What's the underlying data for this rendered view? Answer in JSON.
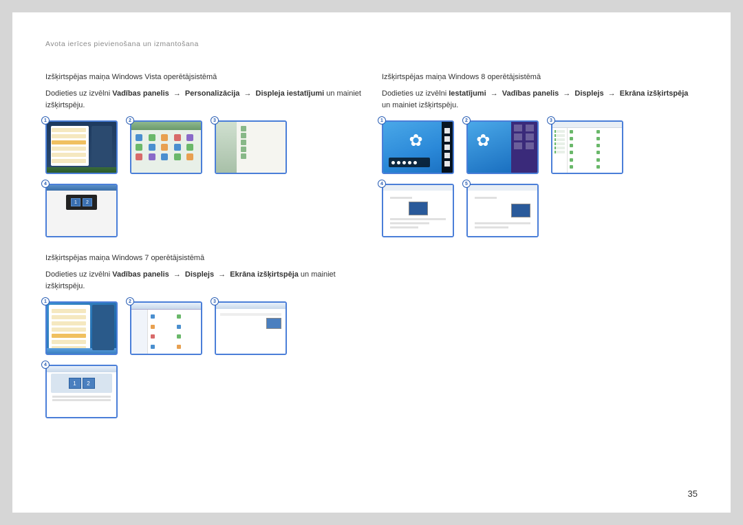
{
  "header": "Avota ierīces pievienošana un izmantošana",
  "page_number": "35",
  "arrow": "→",
  "sections": {
    "vista": {
      "title": "Izšķirtspējas maiņa Windows Vista operētājsistēmā",
      "instr_prefix": "Dodieties uz izvēlni ",
      "path": [
        "Vadības panelis",
        "Personalizācija",
        "Displeja iestatījumi"
      ],
      "instr_suffix": " un mainiet izšķirtspēju.",
      "badges": [
        "1",
        "2",
        "3",
        "4"
      ]
    },
    "win7": {
      "title": "Izšķirtspējas maiņa Windows 7 operētājsistēmā",
      "instr_prefix": "Dodieties uz izvēlni ",
      "path": [
        "Vadības panelis",
        "Displejs",
        "Ekrāna izšķirtspēja"
      ],
      "instr_suffix": " un mainiet izšķirtspēju.",
      "badges": [
        "1",
        "2",
        "3",
        "4"
      ]
    },
    "win8": {
      "title": "Izšķirtspējas maiņa Windows 8 operētājsistēmā",
      "instr_prefix": "Dodieties uz izvēlni ",
      "path": [
        "Iestatījumi",
        "Vadības panelis",
        "Displejs",
        "Ekrāna izšķirtspēja"
      ],
      "instr_suffix": " un mainiet izšķirtspēju.",
      "badges": [
        "1",
        "2",
        "3",
        "4",
        "5"
      ]
    }
  }
}
